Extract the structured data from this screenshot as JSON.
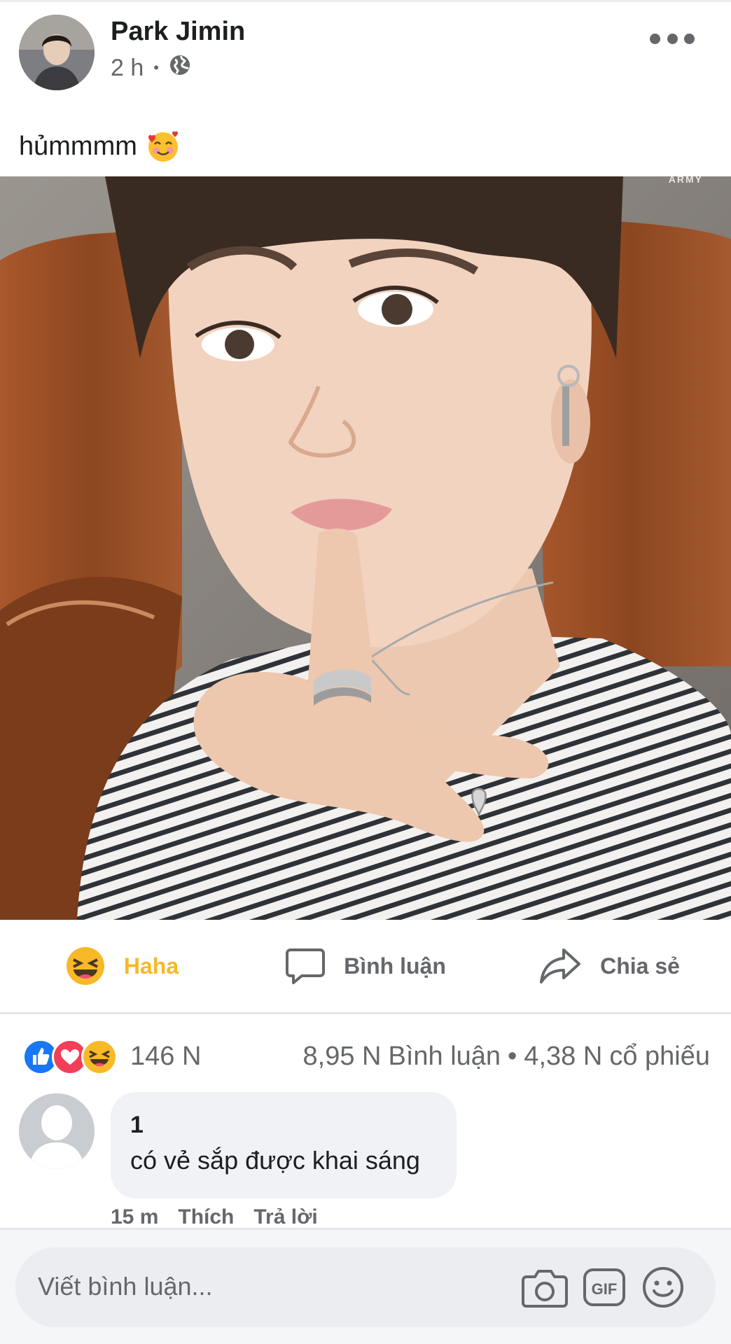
{
  "post": {
    "author": "Park Jimin",
    "time": "2 h",
    "separator": "•",
    "privacy_icon": "globe-icon",
    "text": "hủmmmm",
    "text_emoji": "smiling-face-with-hearts",
    "watermark": "ARMY"
  },
  "actions": {
    "haha_label": "Haha",
    "comment_label": "Bình luận",
    "share_label": "Chia sẻ",
    "haha_color": "#f7b928",
    "inactive_color": "#65676b"
  },
  "stats": {
    "reactions": [
      "like",
      "love",
      "haha"
    ],
    "reaction_count": "146 N",
    "comments_count": "8,95 N",
    "comments_label": "Bình luận",
    "separator": "•",
    "shares_count": "4,38 N",
    "shares_label": "cổ phiếu"
  },
  "comment": {
    "name": "1",
    "text": "có vẻ sắp được khai sáng",
    "time": "15 m",
    "like_label": "Thích",
    "reply_label": "Trả lời"
  },
  "composer": {
    "placeholder": "Viết bình luận...",
    "icons": [
      "camera-icon",
      "gif-icon",
      "emoji-icon"
    ]
  },
  "colors": {
    "like_blue": "#1877f2",
    "love_red": "#f33e58",
    "text_secondary": "#65676b",
    "bubble_bg": "#f0f2f5"
  }
}
